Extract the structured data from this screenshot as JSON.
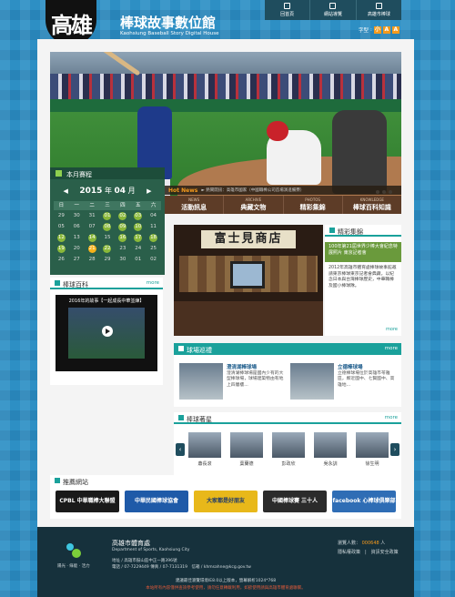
{
  "header": {
    "logo_text": "高雄",
    "title": "棒球故事數位館",
    "subtitle": "Kaohsiung Baseball Story Digital House",
    "nav": [
      "回首頁",
      "網站導覽",
      "高雄市棒球"
    ],
    "font_size_label": "字型",
    "font_buttons": [
      "小",
      "A",
      "A"
    ]
  },
  "calendar": {
    "title": "本月賽程",
    "year": "2015",
    "month": "04",
    "year_suffix": "年",
    "month_suffix": "月",
    "prev": "◀",
    "next": "▶",
    "weekdays": [
      "日",
      "一",
      "二",
      "三",
      "四",
      "五",
      "六"
    ],
    "days": [
      {
        "d": "29",
        "e": false
      },
      {
        "d": "30",
        "e": false
      },
      {
        "d": "31",
        "e": false
      },
      {
        "d": "01",
        "e": true
      },
      {
        "d": "02",
        "e": true
      },
      {
        "d": "03",
        "e": true
      },
      {
        "d": "04",
        "e": false
      },
      {
        "d": "05",
        "e": false
      },
      {
        "d": "06",
        "e": false
      },
      {
        "d": "07",
        "e": false
      },
      {
        "d": "08",
        "e": true
      },
      {
        "d": "09",
        "e": true
      },
      {
        "d": "10",
        "e": true
      },
      {
        "d": "11",
        "e": false
      },
      {
        "d": "12",
        "e": true
      },
      {
        "d": "13",
        "e": false
      },
      {
        "d": "14",
        "e": true
      },
      {
        "d": "15",
        "e": false
      },
      {
        "d": "16",
        "e": true
      },
      {
        "d": "17",
        "e": true
      },
      {
        "d": "18",
        "e": true
      },
      {
        "d": "19",
        "e": true
      },
      {
        "d": "20",
        "e": false
      },
      {
        "d": "21",
        "e": true,
        "t": true
      },
      {
        "d": "22",
        "e": true
      },
      {
        "d": "23",
        "e": false
      },
      {
        "d": "24",
        "e": false
      },
      {
        "d": "25",
        "e": false
      },
      {
        "d": "26",
        "e": false
      },
      {
        "d": "27",
        "e": false
      },
      {
        "d": "28",
        "e": false
      },
      {
        "d": "29",
        "e": false
      },
      {
        "d": "30",
        "e": false
      },
      {
        "d": "01",
        "e": false
      },
      {
        "d": "02",
        "e": false
      }
    ]
  },
  "news": {
    "label": "Hot News",
    "text": "► 熱鬧開訊：高雄市國家（中國職棒公司首場演進備賽）"
  },
  "categories": [
    {
      "en": "NEWS",
      "zh": "活動訊息"
    },
    {
      "en": "ARCHIVE",
      "zh": "典藏文物"
    },
    {
      "en": "PHOTOS",
      "zh": "精彩集錦"
    },
    {
      "en": "KNOWLEDGE",
      "zh": "棒球百科知識"
    }
  ],
  "encyclopedia": {
    "title": "棒球百科",
    "more": "more",
    "video_caption": "2016年的故事【一起成長中華並練】"
  },
  "highlights": {
    "photo_sign": "富士見商店",
    "title": "精彩集錦",
    "box_text": "100年第21屆世界少棒大會紀念特展照片 東京記者會",
    "text": "2012年高雄市體育處棒球故事館邀請東京棒球東京記者會典藏，以紀念日本與台灣棒球歷史，中華職棒及國小棒球隊。",
    "more": "more"
  },
  "stadium": {
    "title": "球場巡禮",
    "more": "more",
    "items": [
      {
        "name": "澄清湖棒球場",
        "desc": "澄清湖棒球場是國內少有的大型棒球場，球場建築物由有地上四層樓..."
      },
      {
        "name": "立德棒球場",
        "desc": "立德棒球場位於高雄市苓雅區，鄰近國中、七賢國中、高雄地..."
      }
    ]
  },
  "stars": {
    "title": "棒球著星",
    "more": "more",
    "prev": "‹",
    "next": "›",
    "people": [
      "蕭長滾",
      "葉蘭德",
      "彭政欣",
      "吳永訓",
      "徐生明"
    ]
  },
  "links": {
    "title": "推薦網站",
    "banners": [
      {
        "label": "CPBL 中華職棒大聯盟",
        "color": "#1a1a1a"
      },
      {
        "label": "中華民國棒球協會",
        "color": "#1f5aa8"
      },
      {
        "label": "大家都是好朋友",
        "color": "#e8b81a"
      },
      {
        "label": "中國棒球賽 三十人",
        "color": "#2b2b2b"
      },
      {
        "label": "facebook 心棒球俱樂部",
        "color": "#2f6db5"
      }
    ]
  },
  "footer": {
    "tagline": "陽光 · 綠能 · 活力",
    "org": "高雄市體育處",
    "org_en": "Department of Sports, Kaohsiung City",
    "address": "地址 / 高雄市鼓山區中正一路396號",
    "contact": "電話 / 07-7229449 傳真 / 07-7131319　信箱 / khmsahne@kcg.gov.tw",
    "visitors_label": "瀏覽人數：",
    "visitors_count": "000648",
    "visitors_suffix": "人",
    "links": "隱私權政策　|　資訊安全政策",
    "note1": "建議最佳瀏覽環境IE8.0以上版本，螢幕解析1024*768",
    "note2": "本站所有內容僅供查詢參考使用，請勿任意轉載利用，如欲使用請與高雄市體育處聯繫。"
  }
}
